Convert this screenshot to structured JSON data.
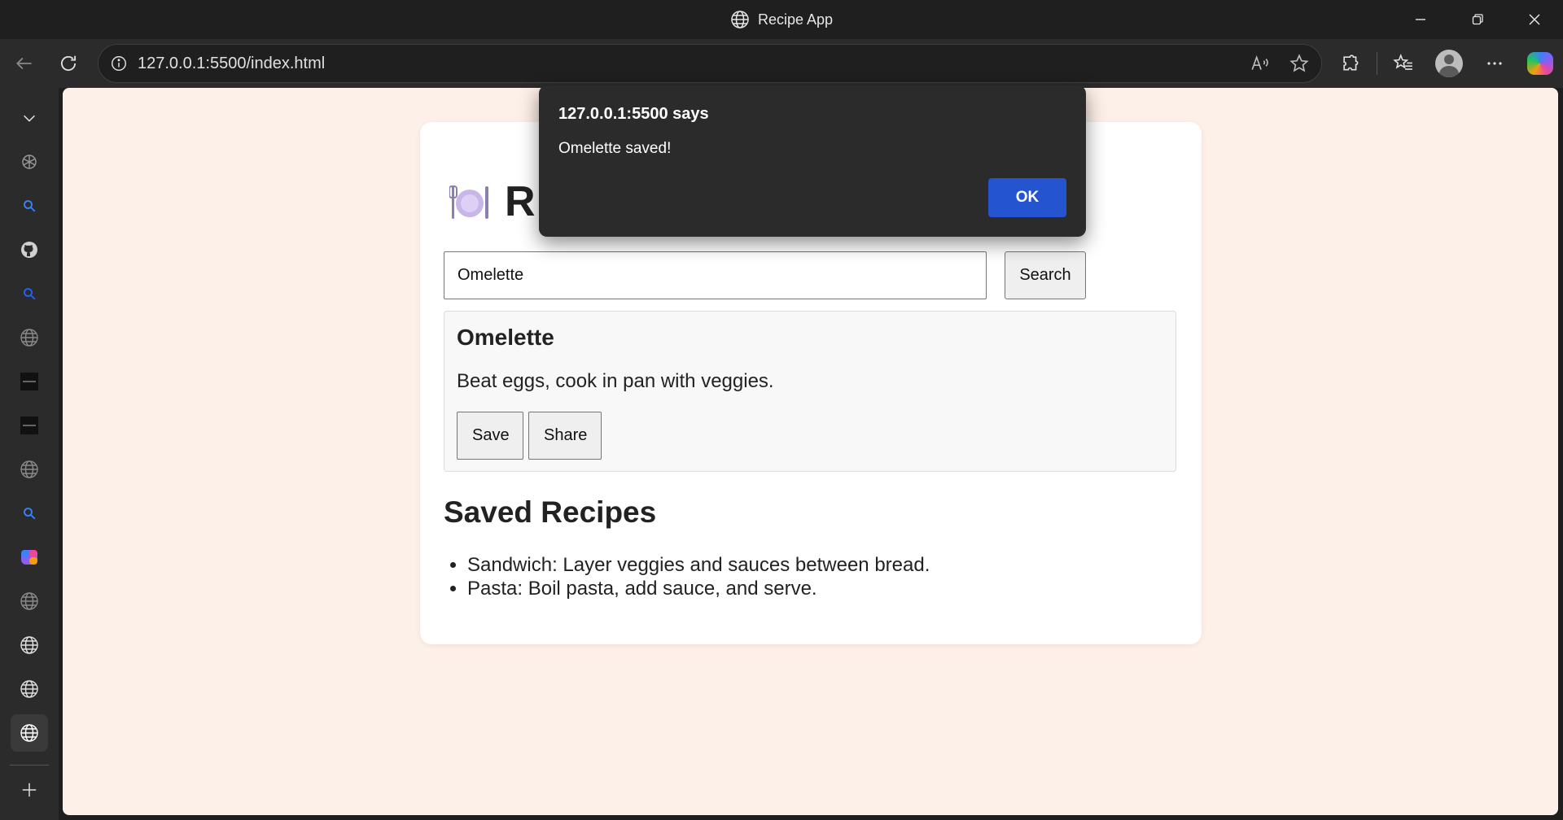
{
  "window": {
    "title": "Recipe App"
  },
  "browser": {
    "url": "127.0.0.1:5500/index.html"
  },
  "sidebar": {
    "items": [
      {
        "icon": "chevron-down-icon"
      },
      {
        "icon": "openai-icon"
      },
      {
        "icon": "search-icon"
      },
      {
        "icon": "github-icon"
      },
      {
        "icon": "search-icon"
      },
      {
        "icon": "globe-icon"
      },
      {
        "icon": "app-tile-icon"
      },
      {
        "icon": "app-tile-icon"
      },
      {
        "icon": "globe-icon"
      },
      {
        "icon": "search-icon"
      },
      {
        "icon": "copilot-icon"
      },
      {
        "icon": "globe-icon"
      },
      {
        "icon": "globe-icon"
      },
      {
        "icon": "globe-icon"
      },
      {
        "icon": "globe-icon"
      },
      {
        "icon": "plus-icon"
      }
    ]
  },
  "app": {
    "title_visible": "R",
    "search": {
      "value": "Omelette",
      "button_label": "Search"
    },
    "result": {
      "name": "Omelette",
      "instructions": "Beat eggs, cook in pan with veggies.",
      "save_label": "Save",
      "share_label": "Share"
    },
    "saved": {
      "heading": "Saved Recipes",
      "items": [
        "Sandwich: Layer veggies and sauces between bread.",
        "Pasta: Boil pasta, add sauce, and serve."
      ]
    }
  },
  "dialog": {
    "title": "127.0.0.1:5500 says",
    "message": "Omelette saved!",
    "ok_label": "OK"
  },
  "colors": {
    "page_background": "#fdf0e8",
    "ok_button": "#2454d0",
    "chrome": "#2b2b2b"
  }
}
